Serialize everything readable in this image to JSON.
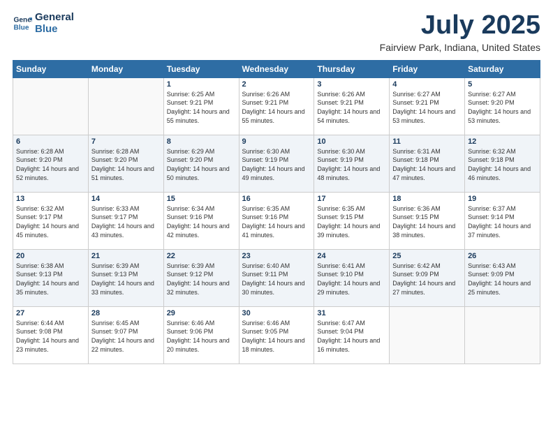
{
  "header": {
    "logo_line1": "General",
    "logo_line2": "Blue",
    "month": "July 2025",
    "location": "Fairview Park, Indiana, United States"
  },
  "weekdays": [
    "Sunday",
    "Monday",
    "Tuesday",
    "Wednesday",
    "Thursday",
    "Friday",
    "Saturday"
  ],
  "weeks": [
    [
      {
        "day": "",
        "info": ""
      },
      {
        "day": "",
        "info": ""
      },
      {
        "day": "1",
        "info": "Sunrise: 6:25 AM\nSunset: 9:21 PM\nDaylight: 14 hours and 55 minutes."
      },
      {
        "day": "2",
        "info": "Sunrise: 6:26 AM\nSunset: 9:21 PM\nDaylight: 14 hours and 55 minutes."
      },
      {
        "day": "3",
        "info": "Sunrise: 6:26 AM\nSunset: 9:21 PM\nDaylight: 14 hours and 54 minutes."
      },
      {
        "day": "4",
        "info": "Sunrise: 6:27 AM\nSunset: 9:21 PM\nDaylight: 14 hours and 53 minutes."
      },
      {
        "day": "5",
        "info": "Sunrise: 6:27 AM\nSunset: 9:20 PM\nDaylight: 14 hours and 53 minutes."
      }
    ],
    [
      {
        "day": "6",
        "info": "Sunrise: 6:28 AM\nSunset: 9:20 PM\nDaylight: 14 hours and 52 minutes."
      },
      {
        "day": "7",
        "info": "Sunrise: 6:28 AM\nSunset: 9:20 PM\nDaylight: 14 hours and 51 minutes."
      },
      {
        "day": "8",
        "info": "Sunrise: 6:29 AM\nSunset: 9:20 PM\nDaylight: 14 hours and 50 minutes."
      },
      {
        "day": "9",
        "info": "Sunrise: 6:30 AM\nSunset: 9:19 PM\nDaylight: 14 hours and 49 minutes."
      },
      {
        "day": "10",
        "info": "Sunrise: 6:30 AM\nSunset: 9:19 PM\nDaylight: 14 hours and 48 minutes."
      },
      {
        "day": "11",
        "info": "Sunrise: 6:31 AM\nSunset: 9:18 PM\nDaylight: 14 hours and 47 minutes."
      },
      {
        "day": "12",
        "info": "Sunrise: 6:32 AM\nSunset: 9:18 PM\nDaylight: 14 hours and 46 minutes."
      }
    ],
    [
      {
        "day": "13",
        "info": "Sunrise: 6:32 AM\nSunset: 9:17 PM\nDaylight: 14 hours and 45 minutes."
      },
      {
        "day": "14",
        "info": "Sunrise: 6:33 AM\nSunset: 9:17 PM\nDaylight: 14 hours and 43 minutes."
      },
      {
        "day": "15",
        "info": "Sunrise: 6:34 AM\nSunset: 9:16 PM\nDaylight: 14 hours and 42 minutes."
      },
      {
        "day": "16",
        "info": "Sunrise: 6:35 AM\nSunset: 9:16 PM\nDaylight: 14 hours and 41 minutes."
      },
      {
        "day": "17",
        "info": "Sunrise: 6:35 AM\nSunset: 9:15 PM\nDaylight: 14 hours and 39 minutes."
      },
      {
        "day": "18",
        "info": "Sunrise: 6:36 AM\nSunset: 9:15 PM\nDaylight: 14 hours and 38 minutes."
      },
      {
        "day": "19",
        "info": "Sunrise: 6:37 AM\nSunset: 9:14 PM\nDaylight: 14 hours and 37 minutes."
      }
    ],
    [
      {
        "day": "20",
        "info": "Sunrise: 6:38 AM\nSunset: 9:13 PM\nDaylight: 14 hours and 35 minutes."
      },
      {
        "day": "21",
        "info": "Sunrise: 6:39 AM\nSunset: 9:13 PM\nDaylight: 14 hours and 33 minutes."
      },
      {
        "day": "22",
        "info": "Sunrise: 6:39 AM\nSunset: 9:12 PM\nDaylight: 14 hours and 32 minutes."
      },
      {
        "day": "23",
        "info": "Sunrise: 6:40 AM\nSunset: 9:11 PM\nDaylight: 14 hours and 30 minutes."
      },
      {
        "day": "24",
        "info": "Sunrise: 6:41 AM\nSunset: 9:10 PM\nDaylight: 14 hours and 29 minutes."
      },
      {
        "day": "25",
        "info": "Sunrise: 6:42 AM\nSunset: 9:09 PM\nDaylight: 14 hours and 27 minutes."
      },
      {
        "day": "26",
        "info": "Sunrise: 6:43 AM\nSunset: 9:09 PM\nDaylight: 14 hours and 25 minutes."
      }
    ],
    [
      {
        "day": "27",
        "info": "Sunrise: 6:44 AM\nSunset: 9:08 PM\nDaylight: 14 hours and 23 minutes."
      },
      {
        "day": "28",
        "info": "Sunrise: 6:45 AM\nSunset: 9:07 PM\nDaylight: 14 hours and 22 minutes."
      },
      {
        "day": "29",
        "info": "Sunrise: 6:46 AM\nSunset: 9:06 PM\nDaylight: 14 hours and 20 minutes."
      },
      {
        "day": "30",
        "info": "Sunrise: 6:46 AM\nSunset: 9:05 PM\nDaylight: 14 hours and 18 minutes."
      },
      {
        "day": "31",
        "info": "Sunrise: 6:47 AM\nSunset: 9:04 PM\nDaylight: 14 hours and 16 minutes."
      },
      {
        "day": "",
        "info": ""
      },
      {
        "day": "",
        "info": ""
      }
    ]
  ]
}
